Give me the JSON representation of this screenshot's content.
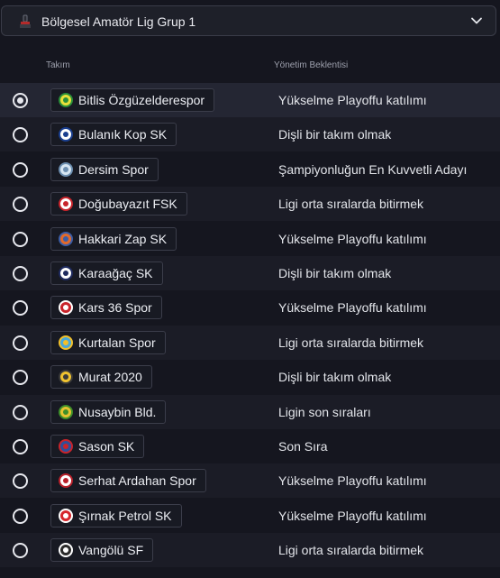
{
  "league_selector": {
    "name": "Bölgesel Amatör Lig Grup 1",
    "icon": "trophy-icon",
    "dropdown_icon": "chevron-down-icon"
  },
  "table": {
    "columns": {
      "team": "Takım",
      "expectation": "Yönetim Beklentisi"
    },
    "rows": [
      {
        "team": "Bitlis Özgüzelderespor",
        "expectation": "Yükselme Playoffu katılımı",
        "selected": true,
        "crest_colors": [
          "#e8e03a",
          "#2a8f3a"
        ]
      },
      {
        "team": "Bulanık Kop SK",
        "expectation": "Dişli bir takım olmak",
        "selected": false,
        "crest_colors": [
          "#ffffff",
          "#1a3f8f"
        ]
      },
      {
        "team": "Dersim Spor",
        "expectation": "Şampiyonluğun En Kuvvetli Adayı",
        "selected": false,
        "crest_colors": [
          "#d7e6f2",
          "#6d8fb0"
        ]
      },
      {
        "team": "Doğubayazıt FSK",
        "expectation": "Ligi orta sıralarda bitirmek",
        "selected": false,
        "crest_colors": [
          "#ffffff",
          "#c8242b"
        ]
      },
      {
        "team": "Hakkari Zap SK",
        "expectation": "Yükselme Playoffu katılımı",
        "selected": false,
        "crest_colors": [
          "#e36a2a",
          "#3b5ea8"
        ]
      },
      {
        "team": "Karaağaç SK",
        "expectation": "Dişli bir takım olmak",
        "selected": false,
        "crest_colors": [
          "#ffffff",
          "#1e2a5e"
        ]
      },
      {
        "team": "Kars 36 Spor",
        "expectation": "Yükselme Playoffu katılımı",
        "selected": false,
        "crest_colors": [
          "#c8242b",
          "#ffffff"
        ]
      },
      {
        "team": "Kurtalan Spor",
        "expectation": "Ligi orta sıralarda bitirmek",
        "selected": false,
        "crest_colors": [
          "#4aa8d8",
          "#f2c02a"
        ]
      },
      {
        "team": "Murat 2020",
        "expectation": "Dişli bir takım olmak",
        "selected": false,
        "crest_colors": [
          "#f0c330",
          "#3a3a3a"
        ]
      },
      {
        "team": "Nusaybin Bld.",
        "expectation": "Ligin son sıraları",
        "selected": false,
        "crest_colors": [
          "#e6c430",
          "#3e8f2a"
        ]
      },
      {
        "team": "Sason SK",
        "expectation": "Son Sıra",
        "selected": false,
        "crest_colors": [
          "#2e4f9a",
          "#c8242b"
        ]
      },
      {
        "team": "Serhat Ardahan Spor",
        "expectation": "Yükselme Playoffu katılımı",
        "selected": false,
        "crest_colors": [
          "#ffffff",
          "#b8202a"
        ]
      },
      {
        "team": "Şırnak Petrol SK",
        "expectation": "Yükselme Playoffu katılımı",
        "selected": false,
        "crest_colors": [
          "#d6262b",
          "#ffffff"
        ]
      },
      {
        "team": "Vangölü SF",
        "expectation": "Ligi orta sıralarda bitirmek",
        "selected": false,
        "crest_colors": [
          "#2b2b2b",
          "#ffffff"
        ]
      }
    ]
  }
}
